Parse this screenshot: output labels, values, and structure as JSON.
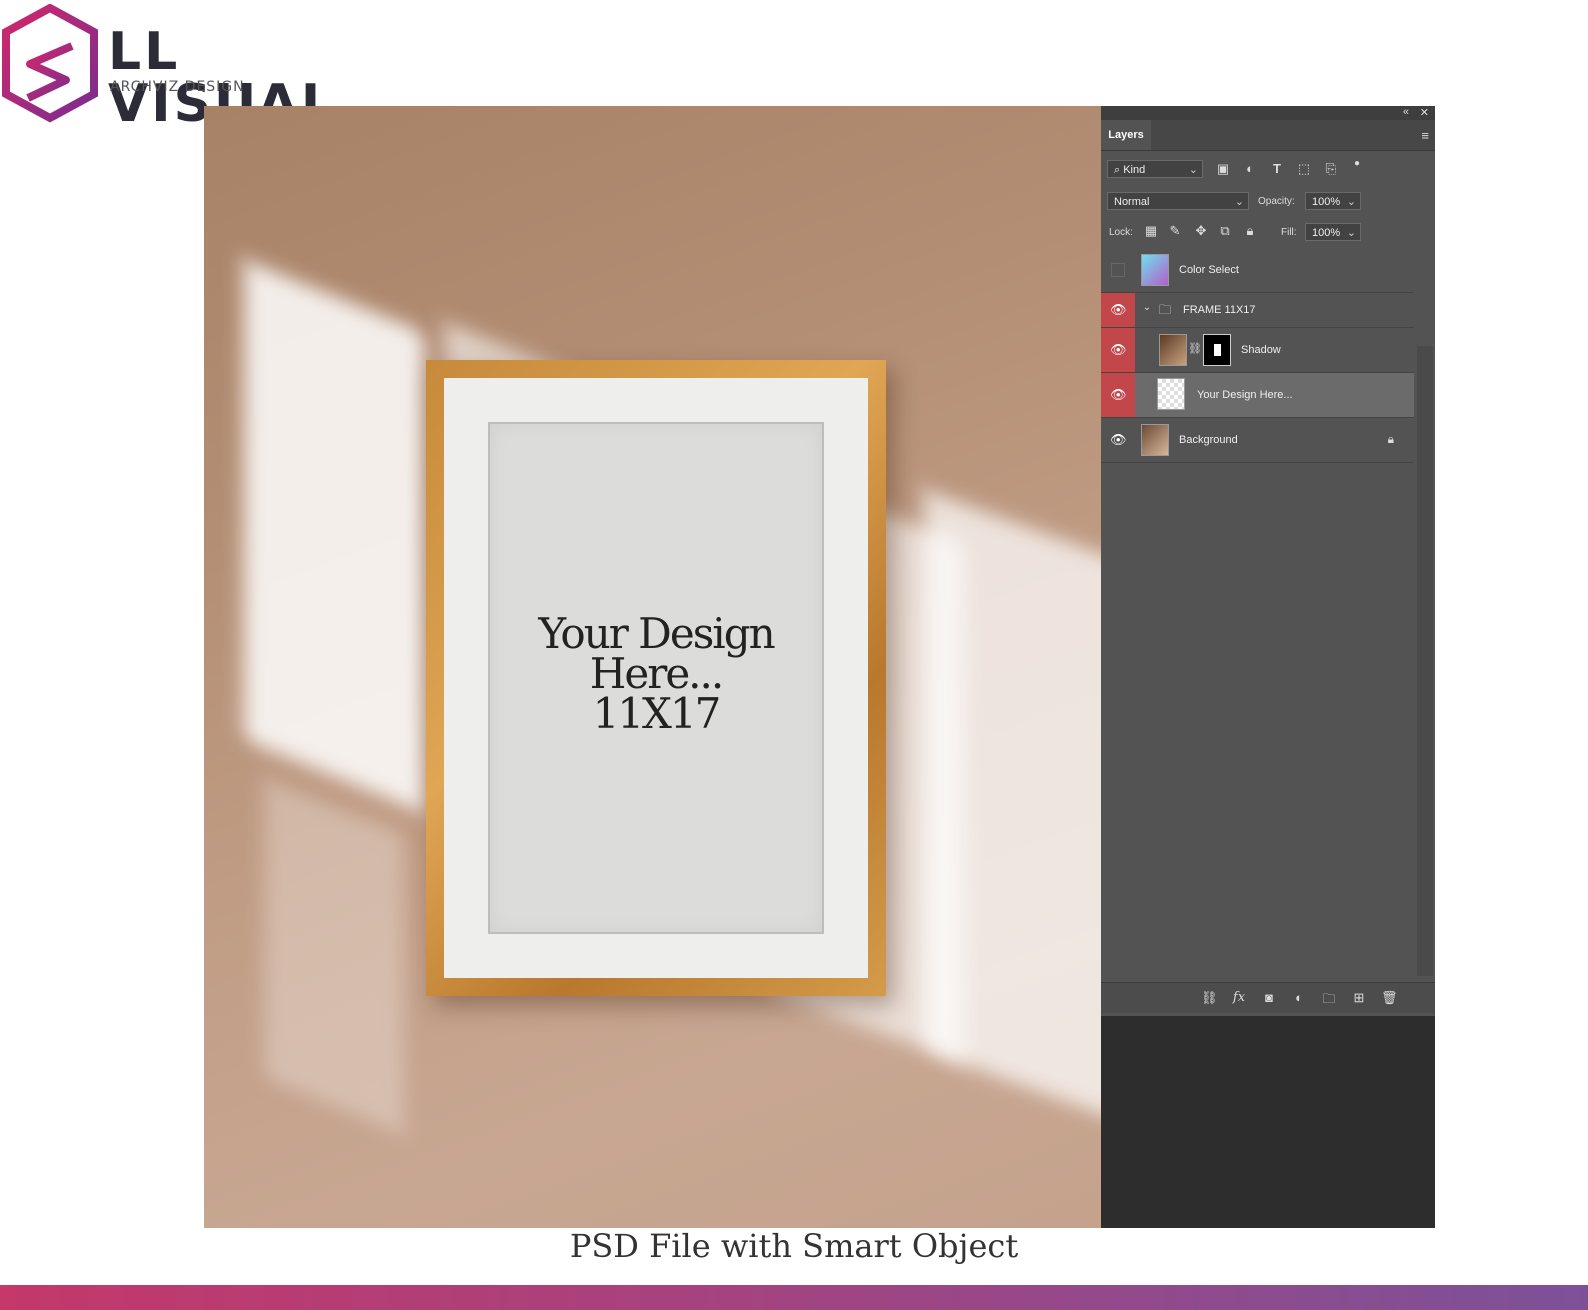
{
  "brand": {
    "name": "LL VISUAL",
    "tagline": "ARCHVIZ DESIGN",
    "colors": {
      "magenta": "#d1286b",
      "purple": "#7a2c8f",
      "dark": "#2c2c38"
    }
  },
  "mockup": {
    "design_text": [
      "Your Design",
      "Here...",
      "11X17"
    ]
  },
  "layers_panel": {
    "tab": "Layers",
    "filter": {
      "kind_label": "Kind"
    },
    "blend_mode": "Normal",
    "opacity_label": "Opacity:",
    "opacity_value": "100%",
    "lock_label": "Lock:",
    "fill_label": "Fill:",
    "fill_value": "100%",
    "layers": [
      {
        "name": "Color Select",
        "visible": false
      },
      {
        "name": "FRAME 11X17",
        "visible": true,
        "type": "group"
      },
      {
        "name": "Shadow",
        "visible": true
      },
      {
        "name": "Your Design Here...",
        "visible": true,
        "selected": true
      },
      {
        "name": "Background",
        "visible": true,
        "locked": true
      }
    ],
    "icons": {
      "top_right": [
        "collapse-icon",
        "close-icon"
      ],
      "filter_icons": [
        "image-filter-icon",
        "adjustment-filter-icon",
        "type-filter-icon",
        "shape-filter-icon",
        "smart-object-filter-icon"
      ],
      "lock_icons": [
        "lock-transparent-icon",
        "lock-paint-icon",
        "lock-move-icon",
        "lock-artboard-icon",
        "lock-all-icon"
      ],
      "bottom_icons": [
        "link-layers-icon",
        "fx-icon",
        "add-mask-icon",
        "adjustment-layer-icon",
        "new-group-icon",
        "new-layer-icon",
        "delete-layer-icon"
      ]
    },
    "accent_color": "#c2474a"
  },
  "caption": "PSD File with Smart Object",
  "footer_gradient": [
    "#c4386a",
    "#7d5198"
  ]
}
